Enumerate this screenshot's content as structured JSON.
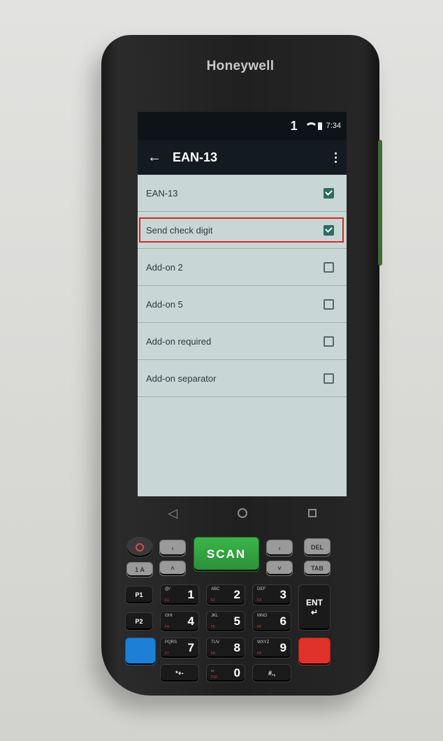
{
  "device": {
    "brand": "Honeywell"
  },
  "status_bar": {
    "notification": "1",
    "time": "7:34",
    "icons": [
      "wifi-icon",
      "battery-icon"
    ]
  },
  "app_bar": {
    "title": "EAN-13",
    "back_icon": "arrow-left-icon",
    "menu_icon": "more-vert-icon"
  },
  "settings": [
    {
      "label": "EAN-13",
      "checked": true
    },
    {
      "label": "Send check digit",
      "checked": true,
      "highlighted": true
    },
    {
      "label": "Add-on 2",
      "checked": false
    },
    {
      "label": "Add-on 5",
      "checked": false
    },
    {
      "label": "Add-on required",
      "checked": false
    },
    {
      "label": "Add-on separator",
      "checked": false
    }
  ],
  "keypad": {
    "scan": "SCAN",
    "tab": "TAB",
    "del": "DEL",
    "p1": "P1",
    "p2": "P2",
    "ent": "ENT",
    "keys": [
      {
        "num": "1",
        "sub": "@/",
        "fn": "F1"
      },
      {
        "num": "2",
        "sub": "ABC",
        "fn": "F2"
      },
      {
        "num": "3",
        "sub": "DEF",
        "fn": "F3"
      },
      {
        "num": "4",
        "sub": "GHI",
        "fn": "F4"
      },
      {
        "num": "5",
        "sub": "JKL",
        "fn": "F5"
      },
      {
        "num": "6",
        "sub": "MNO",
        "fn": "F6"
      },
      {
        "num": "7",
        "sub": "PQRS",
        "fn": "F7"
      },
      {
        "num": "8",
        "sub": "TUV",
        "fn": "F8"
      },
      {
        "num": "9",
        "sub": "WXYZ",
        "fn": "F9"
      },
      {
        "num": "0",
        "sub": "␣",
        "fn": "F10"
      }
    ],
    "star": "*+-",
    "hash": "#.,"
  },
  "colors": {
    "screen_bg": "#c9d6d6",
    "checkbox_checked": "#2f6b62",
    "highlight_border": "#cc2b2b",
    "scan_key": "#3bb54a"
  }
}
